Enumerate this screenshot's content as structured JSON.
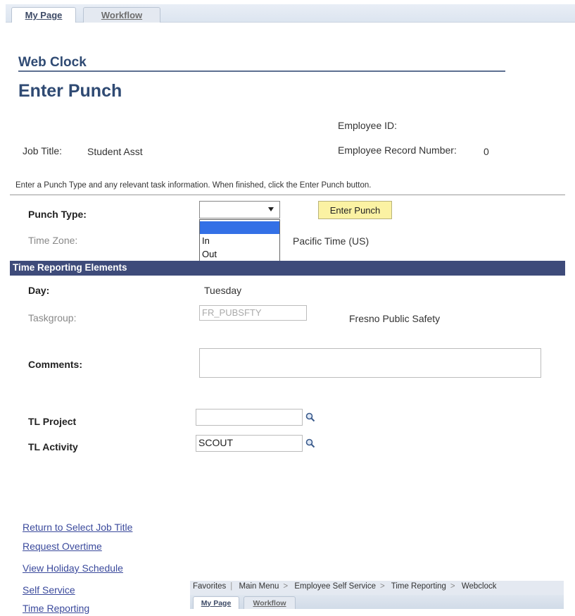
{
  "top_tabs": {
    "my_page": "My Page",
    "workflow": "Workflow"
  },
  "headings": {
    "web_clock": "Web Clock",
    "enter_punch": "Enter Punch"
  },
  "employee": {
    "id_label": "Employee ID:",
    "job_title_label": "Job Title:",
    "job_title_value": "Student Asst",
    "record_label": "Employee Record Number:",
    "record_value": "0"
  },
  "instruction": "Enter a Punch Type and any relevant task information. When finished, click the Enter Punch button.",
  "punch": {
    "type_label": "Punch Type:",
    "type_value": "",
    "options": [
      "",
      "In",
      "Out"
    ],
    "enter_button": "Enter Punch",
    "time_zone_label": "Time Zone:",
    "time_zone_value": "Pacific Time (US)"
  },
  "section": {
    "title": "Time Reporting Elements",
    "day_label": "Day:",
    "day_value": "Tuesday",
    "taskgroup_label": "Taskgroup:",
    "taskgroup_value": "FR_PUBSFTY",
    "taskgroup_desc": "Fresno Public Safety",
    "comments_label": "Comments:",
    "comments_value": "",
    "tl_project_label": "TL Project",
    "tl_project_value": "",
    "tl_activity_label": "TL Activity",
    "tl_activity_value": "SCOUT"
  },
  "links": [
    "Return to Select Job Title",
    "Request Overtime",
    "View Holiday Schedule",
    "Self Service",
    "Time Reporting"
  ],
  "bottom_nav": {
    "favorites": "Favorites",
    "main_menu": "Main Menu",
    "employee_self_service": "Employee Self Service",
    "time_reporting": "Time Reporting",
    "webclock": "Webclock",
    "separator": ">",
    "tabs": {
      "my_page": "My Page",
      "workflow": "Workflow"
    }
  },
  "icons": {
    "lookup": "magnifier-icon",
    "dropdown": "chevron-down-icon"
  },
  "colors": {
    "heading": "#2f4a73",
    "section_bar": "#3e4b7a",
    "button": "#fbf2a3",
    "link": "#3b4a9c",
    "selected_option": "#3370e6"
  }
}
